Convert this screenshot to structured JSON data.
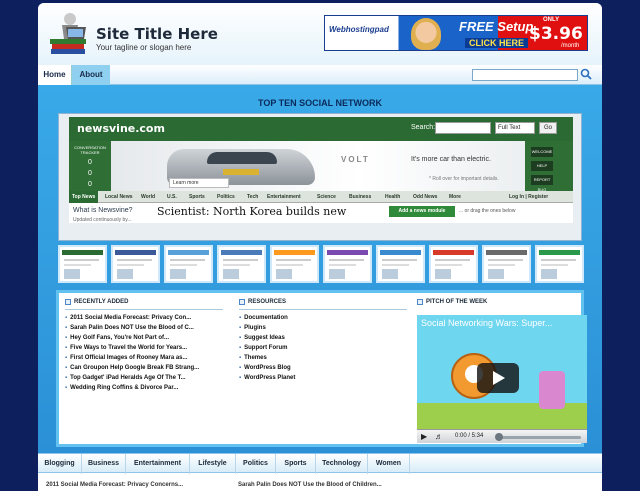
{
  "header": {
    "site_title": "Site Title Here",
    "tagline": "Your tagline or slogan here",
    "banner": {
      "brand": "Webhostingpad",
      "headline": "FREE Setup",
      "cta": "CLICK HERE",
      "only_label": "ONLY",
      "price": "$3.96",
      "per": "/month"
    }
  },
  "nav": {
    "home_label": "Home",
    "about_label": "About"
  },
  "slider": {
    "title": "TOP TEN SOCIAL NETWORK",
    "site": {
      "logo": "newsvine.com",
      "search_label": "Search:",
      "search_scope": "Full Text",
      "go_label": "Go",
      "left_panel": [
        "CONVERSATION TRACKER",
        "0",
        "0",
        "0"
      ],
      "right_panel": [
        "WELCOME",
        "HELP",
        "REPORT BUG"
      ],
      "ad_brand": "VOLT",
      "ad_slogan": "It's more car than electric.",
      "ad_note": "* Roll over for important details.",
      "ad_learn": "Learn more",
      "tabs": [
        "Top News",
        "Local News",
        "World",
        "U.S.",
        "Sports",
        "Politics",
        "Tech",
        "Entertainment",
        "Science",
        "Business",
        "Health",
        "Odd News",
        "More",
        "Log In | Register"
      ],
      "what_is": "What is Newsvine?",
      "updated": "Updated continuously by...",
      "headline": "Scientist: North Korea builds new",
      "add_module": "Add a news module",
      "drag_hint": "... or drag the ones below"
    }
  },
  "recent": {
    "heading": "RECENTLY ADDED",
    "items": [
      "2011 Social Media Forecast: Privacy Con...",
      "Sarah Palin Does NOT Use the Blood of C...",
      "Hey Golf Fans, You're Not Part of...",
      "Five Ways to Travel the World for Years...",
      "First Official Images of Rooney Mara as...",
      "Can Groupon Help Google Break FB Strang...",
      "Top Gadget' iPad Heralds Age Of The T...",
      "Wedding Ring Coffins & Divorce Par..."
    ]
  },
  "resources": {
    "heading": "RESOURCES",
    "items": [
      "Documentation",
      "Plugins",
      "Suggest Ideas",
      "Support Forum",
      "Themes",
      "WordPress Blog",
      "WordPress Planet"
    ]
  },
  "pitch": {
    "heading": "PITCH OF THE WEEK",
    "video_title": "Social Networking Wars: Super...",
    "time": "0:00 / 5:34"
  },
  "footer": {
    "tabs": [
      "Blogging",
      "Business",
      "Entertainment",
      "Lifestyle",
      "Politics",
      "Sports",
      "Technology",
      "Women"
    ],
    "strip": [
      "2011 Social Media Forecast: Privacy Concerns...",
      "Sarah Palin Does NOT Use the Blood of Children..."
    ]
  }
}
